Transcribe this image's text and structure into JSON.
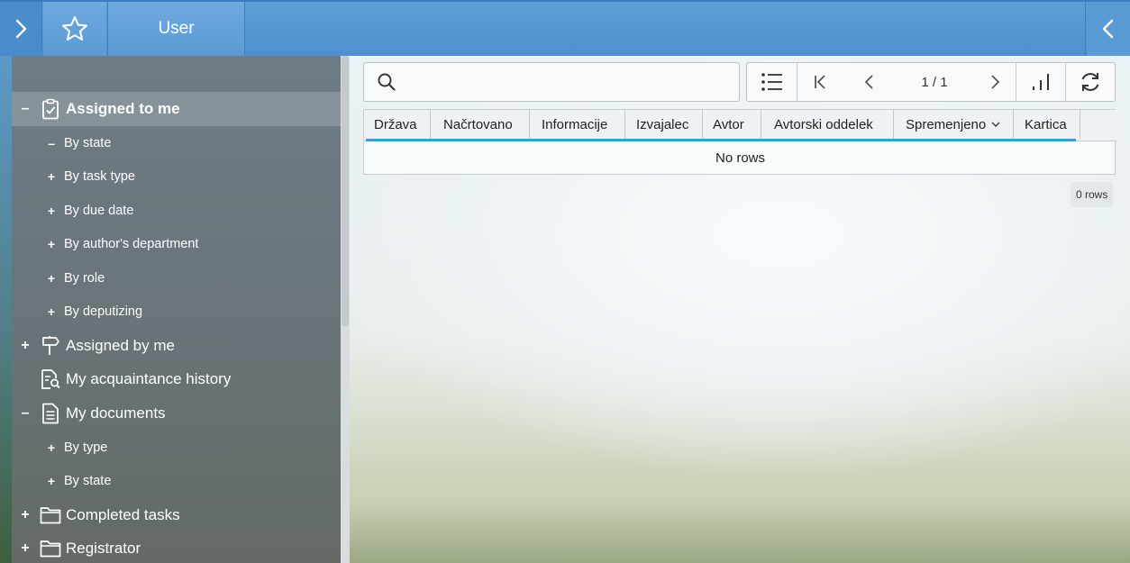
{
  "topbar": {
    "title": "User",
    "expand_icon": "chevron-right-icon",
    "favorite_icon": "star-icon",
    "collapse_icon": "chevron-left-icon"
  },
  "sidebar": {
    "items": [
      {
        "toggle": "–",
        "icon": "clipboard-check-icon",
        "label": "Assigned to me",
        "selected": true
      },
      {
        "toggle": "–",
        "label": "By state"
      },
      {
        "toggle": "+",
        "label": "By task type"
      },
      {
        "toggle": "+",
        "label": "By due date"
      },
      {
        "toggle": "+",
        "label": "By author's department"
      },
      {
        "toggle": "+",
        "label": "By role"
      },
      {
        "toggle": "+",
        "label": "By deputizing"
      },
      {
        "toggle": "+",
        "icon": "signpost-icon",
        "label": "Assigned by me"
      },
      {
        "toggle": "",
        "icon": "document-search-icon",
        "label": "My acquaintance history"
      },
      {
        "toggle": "–",
        "icon": "document-icon",
        "label": "My documents"
      },
      {
        "toggle": "+",
        "label": "By type"
      },
      {
        "toggle": "+",
        "label": "By state"
      },
      {
        "toggle": "+",
        "icon": "folder-icon",
        "label": "Completed tasks"
      },
      {
        "toggle": "+",
        "icon": "folder-icon",
        "label": "Registrator"
      }
    ]
  },
  "search": {
    "icon": "search-icon",
    "value": "",
    "placeholder": ""
  },
  "toolbar": {
    "list_icon": "list-icon",
    "first_icon": "first-page-icon",
    "prev_icon": "chevron-left-icon",
    "page_indicator": "1 / 1",
    "next_icon": "chevron-right-icon",
    "chart_icon": "bar-chart-icon",
    "refresh_icon": "refresh-icon"
  },
  "grid": {
    "columns": [
      "Država",
      "Načrtovano",
      "Informacije",
      "Izvajalec",
      "Avtor",
      "Avtorski oddelek",
      "Spremenjeno",
      "Kartica"
    ],
    "sort_indicator_icon": "chevron-down-icon",
    "empty_text": "No rows",
    "row_count": "0 rows"
  },
  "colors": {
    "topbar": "#5f9fd6",
    "sidebar": "#6a7479",
    "selected_row": "#87939b",
    "sort_accent": "#3c9ad6"
  }
}
